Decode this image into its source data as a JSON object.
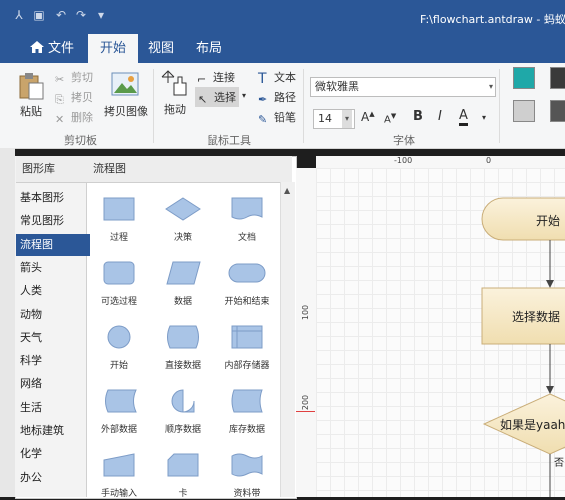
{
  "window": {
    "title": "F:\\flowchart.antdraw - 蚂蚁"
  },
  "tabs": [
    {
      "label": "文件"
    },
    {
      "label": "开始"
    },
    {
      "label": "视图"
    },
    {
      "label": "布局"
    }
  ],
  "ribbon": {
    "clipboard": {
      "paste": "粘贴",
      "cut": "剪切",
      "copy": "拷贝",
      "delete": "删除",
      "copy_image": "拷贝图像",
      "group": "剪切板"
    },
    "mouse_tools": {
      "drag": "拖动",
      "connect": "连接",
      "select": "选择",
      "text": "文本",
      "path": "路径",
      "pencil": "铅笔",
      "group": "鼠标工具"
    },
    "font": {
      "family": "微软雅黑",
      "size": "14",
      "group": "字体",
      "bold": "B",
      "italic": "I",
      "underline": "A"
    },
    "colors": {
      "teal": "#1fa8a8",
      "gray_light": "#cfcfcf",
      "gray_dark": "#555555"
    }
  },
  "library": {
    "header_left": "图形库",
    "header_right": "流程图",
    "categories": [
      "基本图形",
      "常见图形",
      "流程图",
      "箭头",
      "人类",
      "动物",
      "天气",
      "科学",
      "网络",
      "生活",
      "地标建筑",
      "化学",
      "办公"
    ],
    "selected": "流程图",
    "shapes": [
      "过程",
      "决策",
      "文档",
      "可选过程",
      "数据",
      "开始和结束",
      "开始",
      "直接数据",
      "内部存储器",
      "外部数据",
      "顺序数据",
      "库存数据",
      "手动输入",
      "卡",
      "资料带"
    ]
  },
  "canvas": {
    "ruler_top": [
      "-100",
      "0"
    ],
    "ruler_left": [
      "100",
      "200"
    ],
    "nodes": {
      "start": "开始",
      "select": "选择数据",
      "decision": "如果是yaah",
      "no": "否"
    }
  }
}
